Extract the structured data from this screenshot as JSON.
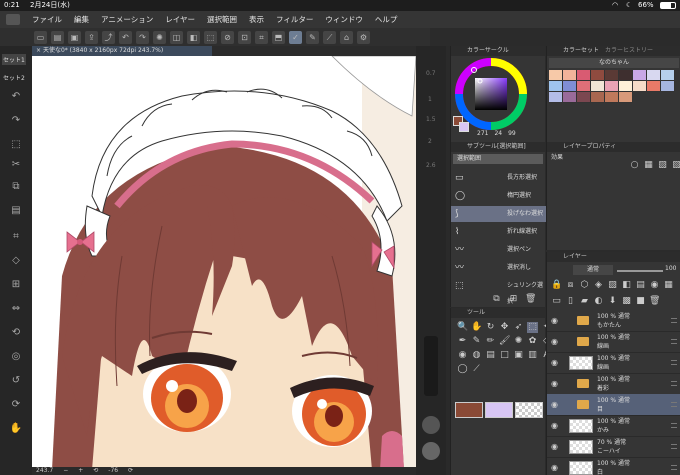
{
  "status_bar": {
    "time": "0:21",
    "date": "2月24日(水)",
    "battery": "66%"
  },
  "menu": [
    "ファイル",
    "編集",
    "アニメーション",
    "レイヤー",
    "選択範囲",
    "表示",
    "フィルター",
    "ウィンドウ",
    "ヘルプ"
  ],
  "left_tabs": {
    "tab1": "セット1",
    "tab2": "セット2"
  },
  "document": {
    "title": "天使な0* (3840 x 2160px 72dpi 243.7%)",
    "zoom": "243.7",
    "angle": "-76"
  },
  "ruler_ticks": [
    "0.7",
    "1",
    "1.5",
    "2",
    "2.6"
  ],
  "color_wheel": {
    "header": "カラーサークル",
    "h": "271",
    "s": "24",
    "v": "99"
  },
  "color_set": {
    "header_tabs": [
      "カラーセット",
      "カラーヒストリー"
    ],
    "set_name": "なのちゃん",
    "swatches": [
      "#f7c9a8",
      "#f2b39a",
      "#d95b72",
      "#8f4b3f",
      "#5a3a35",
      "#3e2f2f",
      "#c9a8e6",
      "#d8d8f0",
      "#b6d0ec",
      "#9fc4ee",
      "#7f8ed6",
      "#e06f78",
      "#f0e6d6",
      "#e9a3b5",
      "#fff1d8",
      "#f6dcc8",
      "#e87a68",
      "#a6b6e0",
      "#b4bde8",
      "#9a6b9a",
      "#7b4750",
      "#a86750",
      "#c0795c",
      "#d89a7a"
    ]
  },
  "layer_property": {
    "header": "レイヤープロパティ",
    "effect_label": "効果"
  },
  "sub_tool": {
    "header": "サブツール[選択範囲]",
    "group": "選択範囲",
    "items": [
      "長方形選択",
      "楕円選択",
      "投げなわ選択",
      "折れ線選択",
      "選択ペン",
      "選択消し",
      "シュリンク選択"
    ],
    "selected_index": 2
  },
  "tool_panel": {
    "header": "ツール"
  },
  "layer_panel": {
    "header": "レイヤー",
    "blend_mode": "通常",
    "opacity": "100",
    "layers": [
      {
        "name": "100 % 通常\nもかたん",
        "type": "folder"
      },
      {
        "name": "100 % 通常\n線画",
        "type": "folder"
      },
      {
        "name": "100 % 通常\n線画",
        "type": "layer"
      },
      {
        "name": "100 % 通常\n着彩",
        "type": "folder"
      },
      {
        "name": "100 % 通常\n目",
        "type": "folder",
        "selected": true
      },
      {
        "name": "100 % 通常\nかみ",
        "type": "layer"
      },
      {
        "name": "70 % 通常\nこーハイ",
        "type": "layer"
      },
      {
        "name": "100 % 通常\n白",
        "type": "layer"
      }
    ]
  },
  "colors": {
    "main": "#8a4a36",
    "sub": "#d8c6f4",
    "accent": "#6a7186"
  }
}
